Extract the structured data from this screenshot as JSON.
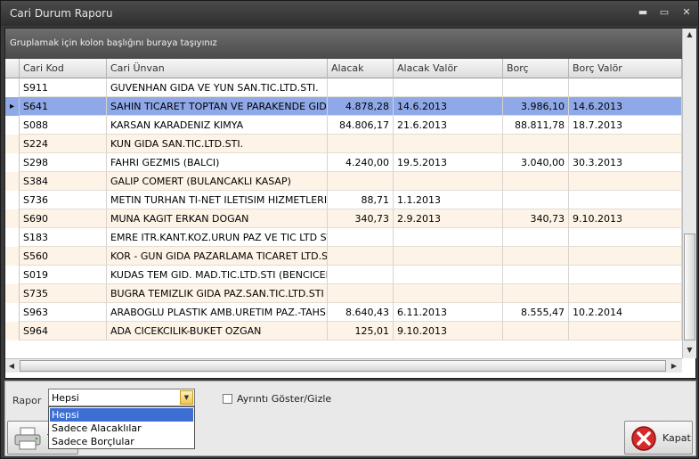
{
  "window": {
    "title": "Cari Durum Raporu",
    "minimize": "▬",
    "maximize": "▭",
    "close": "✕"
  },
  "group_panel_text": "Gruplamak için kolon başlığını buraya taşıyınız",
  "columns": [
    "Cari Kod",
    "Cari Ünvan",
    "Alacak",
    "Alacak Valör",
    "Borç",
    "Borç Valör"
  ],
  "rows": [
    {
      "kod": "S911",
      "unvan": "GUVENHAN GIDA VE YUN SAN.TIC.LTD.STI.",
      "alacak": "",
      "alacak_valor": "",
      "borc": "",
      "borc_valor": ""
    },
    {
      "kod": "S641",
      "unvan": "SAHIN TICARET TOPTAN VE PARAKENDE GIDA ...",
      "alacak": "4.878,28",
      "alacak_valor": "14.6.2013",
      "borc": "3.986,10",
      "borc_valor": "14.6.2013",
      "selected": true
    },
    {
      "kod": "S088",
      "unvan": "KARSAN KARADENIZ KIMYA",
      "alacak": "84.806,17",
      "alacak_valor": "21.6.2013",
      "borc": "88.811,78",
      "borc_valor": "18.7.2013"
    },
    {
      "kod": "S224",
      "unvan": "KUN GIDA SAN.TIC.LTD.STI.",
      "alacak": "",
      "alacak_valor": "",
      "borc": "",
      "borc_valor": ""
    },
    {
      "kod": "S298",
      "unvan": "FAHRI GEZMIS (BALCI)",
      "alacak": "4.240,00",
      "alacak_valor": "19.5.2013",
      "borc": "3.040,00",
      "borc_valor": "30.3.2013"
    },
    {
      "kod": "S384",
      "unvan": "GALIP COMERT (BULANCAKLI KASAP)",
      "alacak": "",
      "alacak_valor": "",
      "borc": "",
      "borc_valor": ""
    },
    {
      "kod": "S736",
      "unvan": "METIN TURHAN TI-NET ILETISIM HIZMETLERI",
      "alacak": "88,71",
      "alacak_valor": "1.1.2013",
      "borc": "",
      "borc_valor": ""
    },
    {
      "kod": "S690",
      "unvan": "MUNA KAGIT ERKAN DOGAN",
      "alacak": "340,73",
      "alacak_valor": "2.9.2013",
      "borc": "340,73",
      "borc_valor": "9.10.2013"
    },
    {
      "kod": "S183",
      "unvan": "EMRE ITR.KANT.KOZ.URUN PAZ VE TIC LTD STI",
      "alacak": "",
      "alacak_valor": "",
      "borc": "",
      "borc_valor": ""
    },
    {
      "kod": "S560",
      "unvan": "KOR - GUN GIDA PAZARLAMA TICARET LTD.STI",
      "alacak": "",
      "alacak_valor": "",
      "borc": "",
      "borc_valor": ""
    },
    {
      "kod": "S019",
      "unvan": "KUDAS TEM GID. MAD.TIC.LTD.STI (BENCICER)",
      "alacak": "",
      "alacak_valor": "",
      "borc": "",
      "borc_valor": ""
    },
    {
      "kod": "S735",
      "unvan": "BUGRA TEMIZLIK GIDA PAZ.SAN.TIC.LTD.STI",
      "alacak": "",
      "alacak_valor": "",
      "borc": "",
      "borc_valor": ""
    },
    {
      "kod": "S963",
      "unvan": "ARABOGLU PLASTIK AMB.URETIM PAZ.-TAHSI...",
      "alacak": "8.640,43",
      "alacak_valor": "6.11.2013",
      "borc": "8.555,47",
      "borc_valor": "10.2.2014"
    },
    {
      "kod": "S964",
      "unvan": "ADA CICEKCILIK-BUKET OZGAN",
      "alacak": "125,01",
      "alacak_valor": "9.10.2013",
      "borc": "",
      "borc_valor": ""
    }
  ],
  "bottom": {
    "rapor_label": "Rapor",
    "rapor_value": "Hepsi",
    "rapor_options": [
      "Hepsi",
      "Sadece Alacaklılar",
      "Sadece Borçlular"
    ],
    "detail_toggle_label": "Ayrıntı Göster/Gizle",
    "print_label": "Y",
    "close_label": "Kapat"
  },
  "colors": {
    "selected_row": "#8fa8e8",
    "alt_row": "#fdf3e6",
    "dropdown_highlight": "#3c6ed4"
  }
}
